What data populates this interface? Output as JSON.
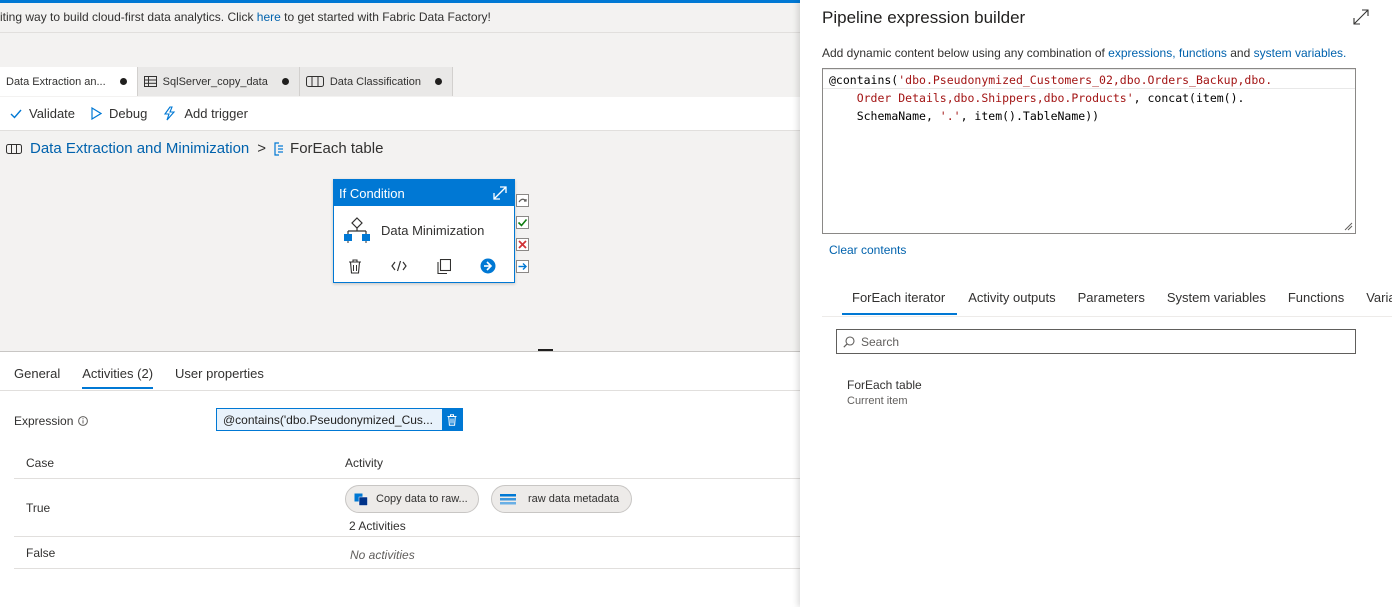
{
  "banner": {
    "text_before": "iting way to build cloud-first data analytics. Click ",
    "link": "here",
    "text_after": " to get started with Fabric Data Factory!"
  },
  "tabs": [
    {
      "label": "Data Extraction an...",
      "active": true
    },
    {
      "label": "SqlServer_copy_data",
      "active": false
    },
    {
      "label": "Data Classification",
      "active": false
    }
  ],
  "toolbar": {
    "validate": "Validate",
    "debug": "Debug",
    "add_trigger": "Add trigger"
  },
  "breadcrumb": {
    "pipeline": "Data Extraction and Minimization",
    "separator": ">",
    "current": "ForEach table"
  },
  "activity": {
    "header": "If Condition",
    "name": "Data Minimization"
  },
  "props": {
    "tabs": [
      "General",
      "Activities (2)",
      "User properties"
    ],
    "expression_label": "Expression",
    "expression_value": "@contains('dbo.Pseudonymized_Cus...",
    "table": {
      "headers": [
        "Case",
        "Activity"
      ],
      "rows": [
        {
          "case": "True",
          "activities": [
            "Copy data to raw...",
            "raw data metadata"
          ],
          "count": "2 Activities"
        },
        {
          "case": "False",
          "none": "No activities"
        }
      ]
    }
  },
  "builder": {
    "title": "Pipeline expression builder",
    "desc_before": "Add dynamic content below using any combination of ",
    "link1": "expressions,",
    "link2": "functions",
    "desc_and": " and ",
    "link3": "system variables.",
    "code": {
      "l1_fn": "@contains(",
      "l1_str": "'dbo.Pseudonymized_Customers_02,dbo.Orders_Backup,dbo.",
      "l2_str": "Order Details,dbo.Shippers,dbo.Products'",
      "l2_rest": ", concat(item().",
      "l3_a": "SchemaName, ",
      "l3_str": "'.'",
      "l3_b": ", item().TableName))"
    },
    "clear": "Clear contents",
    "tabs": [
      "ForEach iterator",
      "Activity outputs",
      "Parameters",
      "System variables",
      "Functions",
      "Varia"
    ],
    "search_placeholder": "Search",
    "item_title": "ForEach table",
    "item_sub": "Current item"
  }
}
